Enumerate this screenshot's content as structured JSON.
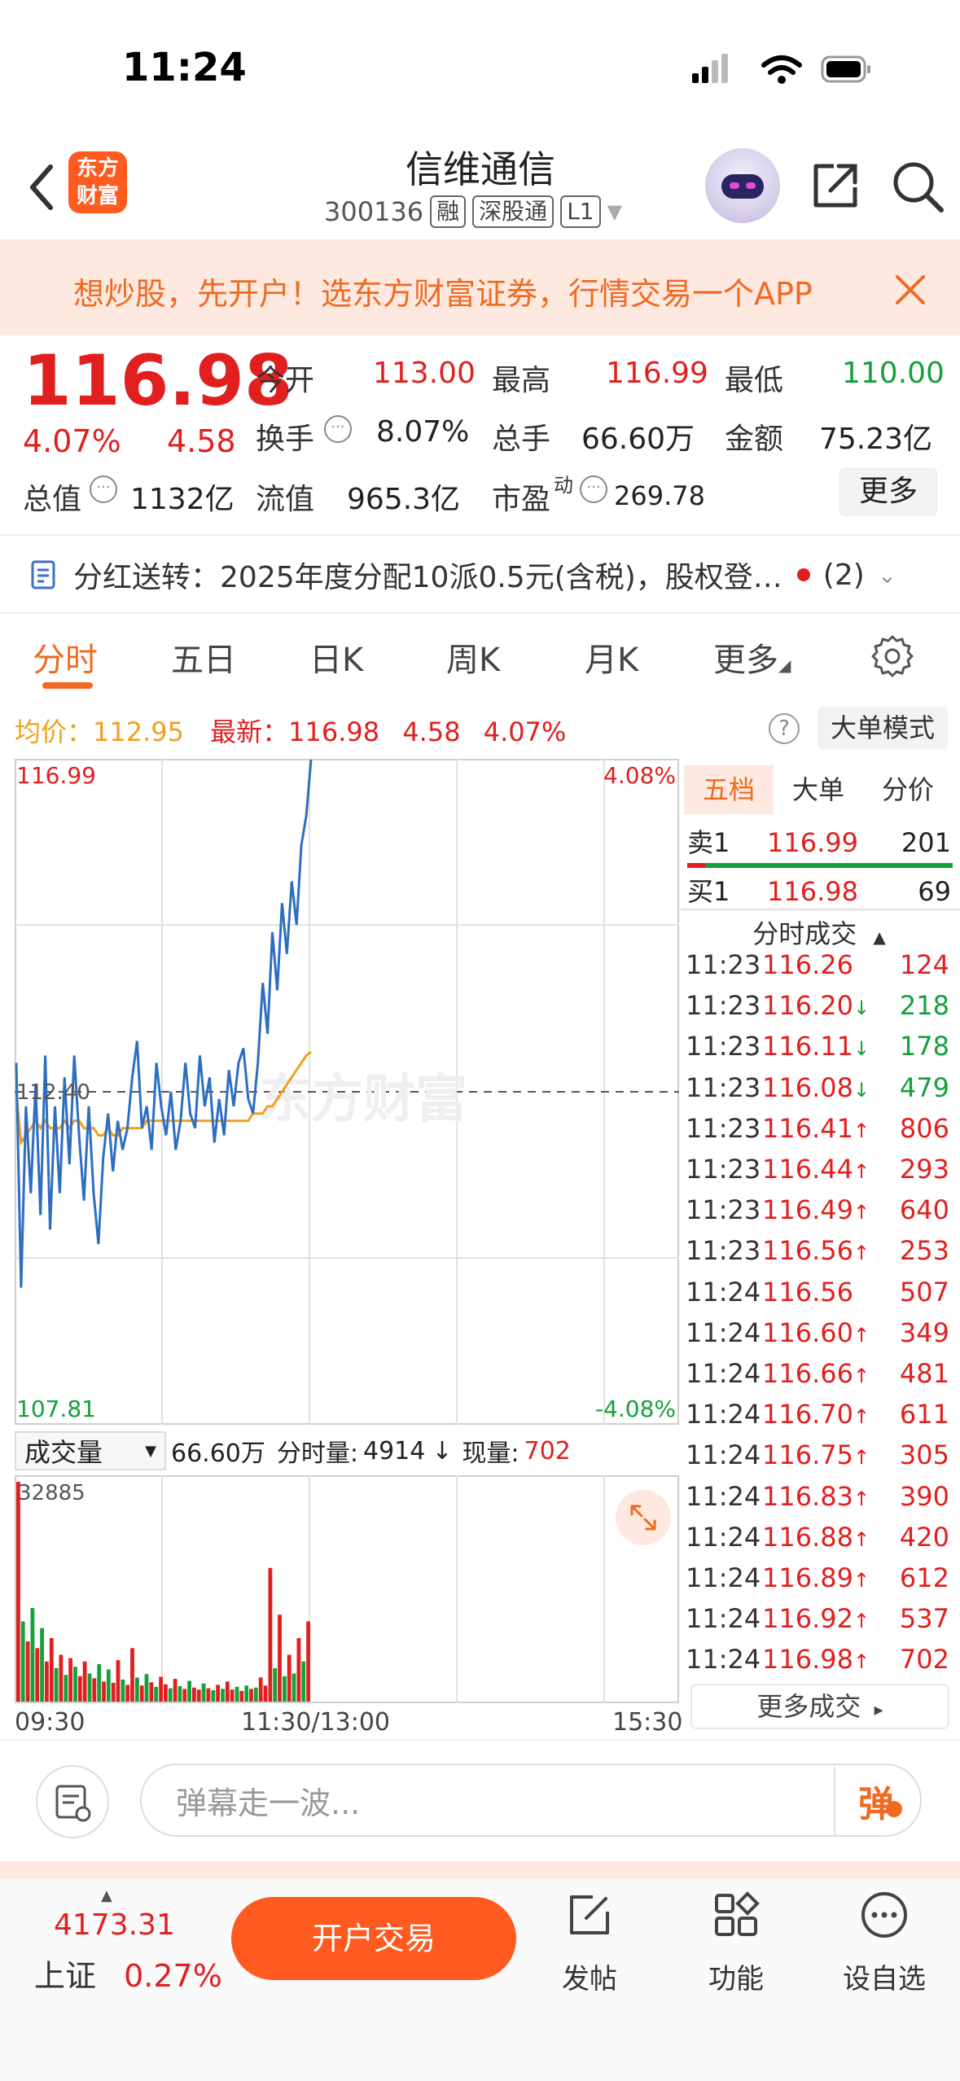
{
  "status_bar": {
    "time": "11:24"
  },
  "header": {
    "logo_text_line1": "东方",
    "logo_text_line2": "财富",
    "stock_name": "信维通信",
    "stock_code": "300136",
    "tags": [
      "融",
      "深股通",
      "L1"
    ]
  },
  "banner": {
    "text": "想炒股，先开户！选东方财富证券，行情交易一个APP"
  },
  "quote": {
    "price": "116.98",
    "change_pct": "4.07%",
    "change": "4.58",
    "open_label": "今开",
    "open": "113.00",
    "high_label": "最高",
    "high": "116.99",
    "low_label": "最低",
    "low": "110.00",
    "turnover_label": "换手",
    "turnover": "8.07%",
    "volume_label": "总手",
    "volume": "66.60万",
    "amount_label": "金额",
    "amount": "75.23亿",
    "mktcap_label": "总值",
    "mktcap": "1132亿",
    "float_label": "流值",
    "float": "965.3亿",
    "pe_label": "市盈",
    "pe_sup": "动",
    "pe": "269.78",
    "more_label": "更多"
  },
  "dividend": {
    "label": "分红送转：",
    "text": "2025年度分配10派0.5元(含税)，股权登…",
    "count": "(2)"
  },
  "tabs": [
    "分时",
    "五日",
    "日K",
    "周K",
    "月K",
    "更多"
  ],
  "chart_header": {
    "avg_label": "均价：",
    "avg": "112.95",
    "last_label": "最新：",
    "last": "116.98",
    "chg": "4.58",
    "pct": "4.07%",
    "help": "?",
    "big_order_label": "大单模式"
  },
  "chart_data": {
    "type": "line",
    "y_max_label": "116.99",
    "y_min_label": "107.81",
    "pct_max_label": "4.08%",
    "pct_min_label": "-4.08%",
    "prev_close_label": "112.40",
    "ylim": [
      107.81,
      116.99
    ],
    "x_labels": [
      "09:30",
      "11:30/13:00",
      "15:30"
    ],
    "watermark": "东方财富",
    "series": [
      {
        "name": "price",
        "color": "#2e6ec1",
        "values": [
          112.8,
          109.7,
          112.2,
          111.0,
          112.5,
          110.7,
          112.9,
          110.5,
          112.2,
          111.0,
          112.6,
          111.4,
          112.9,
          111.8,
          110.9,
          112.2,
          111.0,
          110.3,
          111.5,
          112.1,
          111.3,
          112.0,
          111.6,
          111.9,
          112.6,
          113.1,
          111.9,
          112.2,
          111.6,
          112.8,
          112.2,
          111.8,
          112.4,
          111.6,
          112.0,
          112.8,
          112.1,
          111.9,
          112.9,
          112.2,
          112.6,
          111.7,
          112.3,
          111.8,
          112.7,
          112.2,
          112.8,
          113.0,
          112.3,
          112.1,
          112.8,
          113.9,
          113.2,
          114.6,
          113.8,
          115.0,
          114.3,
          115.3,
          114.7,
          115.8,
          116.2,
          116.98
        ]
      },
      {
        "name": "avg",
        "color": "#f0a020",
        "values": [
          112.4,
          111.7,
          111.8,
          111.9,
          112.0,
          111.9,
          112.0,
          111.9,
          111.9,
          111.9,
          112.0,
          111.9,
          112.0,
          112.0,
          111.9,
          111.9,
          111.9,
          111.8,
          111.8,
          111.9,
          111.8,
          111.8,
          111.9,
          111.9,
          111.9,
          111.9,
          111.9,
          112.0,
          112.0,
          112.0,
          112.0,
          112.0,
          112.0,
          112.0,
          112.0,
          112.0,
          112.0,
          112.0,
          112.0,
          112.0,
          112.0,
          112.0,
          112.0,
          112.0,
          112.0,
          112.0,
          112.0,
          112.0,
          112.0,
          112.1,
          112.1,
          112.1,
          112.2,
          112.2,
          112.3,
          112.4,
          112.5,
          112.6,
          112.7,
          112.8,
          112.9,
          112.95
        ]
      }
    ],
    "volume": {
      "label": "成交量",
      "total": "66.60万",
      "minute_vol_label": "分时量:",
      "minute_vol": "4914",
      "now_label": "现量:",
      "now": "702",
      "max_label": "32885",
      "bars": [
        32885,
        12000,
        9000,
        14000,
        8000,
        11000,
        6000,
        9500,
        5000,
        7000,
        4000,
        6500,
        5200,
        3800,
        6000,
        4200,
        3500,
        5600,
        3000,
        4800,
        2800,
        6200,
        3300,
        2500,
        8000,
        3600,
        2400,
        4100,
        2900,
        2200,
        3700,
        2600,
        2000,
        3400,
        2300,
        1900,
        3100,
        2100,
        1800,
        2700,
        2000,
        1700,
        2500,
        1900,
        3000,
        1800,
        2200,
        1600,
        2400,
        1900,
        2100,
        3600,
        2400,
        20000,
        5000,
        13000,
        3800,
        7000,
        4200,
        9500,
        6000,
        12000
      ],
      "bar_colors": [
        "r",
        "g",
        "r",
        "g",
        "r",
        "g",
        "r",
        "r",
        "g",
        "r",
        "g",
        "r",
        "g",
        "r",
        "r",
        "g",
        "r",
        "g",
        "r",
        "g",
        "r",
        "r",
        "g",
        "r",
        "r",
        "g",
        "r",
        "g",
        "r",
        "g",
        "r",
        "r",
        "g",
        "r",
        "g",
        "r",
        "g",
        "r",
        "r",
        "g",
        "r",
        "g",
        "r",
        "g",
        "r",
        "r",
        "g",
        "r",
        "g",
        "r",
        "g",
        "r",
        "r",
        "r",
        "g",
        "r",
        "g",
        "r",
        "g",
        "r",
        "g",
        "r"
      ]
    }
  },
  "order_book": {
    "tabs": [
      "五档",
      "大单",
      "分价"
    ],
    "sell1_label": "卖1",
    "sell1_price": "116.99",
    "sell1_vol": "201",
    "buy1_label": "买1",
    "buy1_price": "116.98",
    "buy1_vol": "69",
    "ticks_title": "分时成交",
    "ticks": [
      {
        "time": "11:23",
        "price": "116.26",
        "dir": "",
        "vol": "124",
        "vc": "red"
      },
      {
        "time": "11:23",
        "price": "116.20",
        "dir": "↓",
        "vol": "218",
        "vc": "green"
      },
      {
        "time": "11:23",
        "price": "116.11",
        "dir": "↓",
        "vol": "178",
        "vc": "green"
      },
      {
        "time": "11:23",
        "price": "116.08",
        "dir": "↓",
        "vol": "479",
        "vc": "green"
      },
      {
        "time": "11:23",
        "price": "116.41",
        "dir": "↑",
        "vol": "806",
        "vc": "red"
      },
      {
        "time": "11:23",
        "price": "116.44",
        "dir": "↑",
        "vol": "293",
        "vc": "red"
      },
      {
        "time": "11:23",
        "price": "116.49",
        "dir": "↑",
        "vol": "640",
        "vc": "red"
      },
      {
        "time": "11:23",
        "price": "116.56",
        "dir": "↑",
        "vol": "253",
        "vc": "red"
      },
      {
        "time": "11:24",
        "price": "116.56",
        "dir": "",
        "vol": "507",
        "vc": "red"
      },
      {
        "time": "11:24",
        "price": "116.60",
        "dir": "↑",
        "vol": "349",
        "vc": "red"
      },
      {
        "time": "11:24",
        "price": "116.66",
        "dir": "↑",
        "vol": "481",
        "vc": "red"
      },
      {
        "time": "11:24",
        "price": "116.70",
        "dir": "↑",
        "vol": "611",
        "vc": "red"
      },
      {
        "time": "11:24",
        "price": "116.75",
        "dir": "↑",
        "vol": "305",
        "vc": "red"
      },
      {
        "time": "11:24",
        "price": "116.83",
        "dir": "↑",
        "vol": "390",
        "vc": "red"
      },
      {
        "time": "11:24",
        "price": "116.88",
        "dir": "↑",
        "vol": "420",
        "vc": "red"
      },
      {
        "time": "11:24",
        "price": "116.89",
        "dir": "↑",
        "vol": "612",
        "vc": "red"
      },
      {
        "time": "11:24",
        "price": "116.92",
        "dir": "↑",
        "vol": "537",
        "vc": "red"
      },
      {
        "time": "11:24",
        "price": "116.98",
        "dir": "↑",
        "vol": "702",
        "vc": "red"
      }
    ],
    "more_trades": "更多成交"
  },
  "comment": {
    "placeholder": "弹幕走一波...",
    "danmu": "弹"
  },
  "bottom_nav": {
    "index_value": "4173.31",
    "index_name": "上证",
    "index_pct": "0.27%",
    "trade_button": "开户交易",
    "items": [
      "发帖",
      "功能",
      "设自选"
    ]
  }
}
